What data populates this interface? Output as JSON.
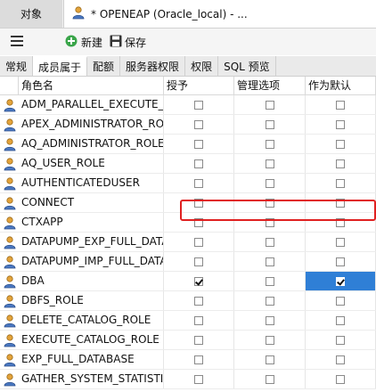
{
  "titlebar": {
    "objects_tab": "对象",
    "doc_tab": "* OPENEAP (Oracle_local) - ..."
  },
  "toolbar": {
    "new_label": "新建",
    "save_label": "保存"
  },
  "tabs": [
    {
      "label": "常规",
      "active": false
    },
    {
      "label": "成员属于",
      "active": true
    },
    {
      "label": "配额",
      "active": false
    },
    {
      "label": "服务器权限",
      "active": false
    },
    {
      "label": "权限",
      "active": false
    },
    {
      "label": "SQL 预览",
      "active": false
    }
  ],
  "grid": {
    "headers": [
      "角色名",
      "授予",
      "管理选项",
      "作为默认"
    ],
    "rows": [
      {
        "name": "ADM_PARALLEL_EXECUTE_TASK",
        "grant": false,
        "admin": false,
        "default": false
      },
      {
        "name": "APEX_ADMINISTRATOR_ROLE",
        "grant": false,
        "admin": false,
        "default": false
      },
      {
        "name": "AQ_ADMINISTRATOR_ROLE",
        "grant": false,
        "admin": false,
        "default": false
      },
      {
        "name": "AQ_USER_ROLE",
        "grant": false,
        "admin": false,
        "default": false
      },
      {
        "name": "AUTHENTICATEDUSER",
        "grant": false,
        "admin": false,
        "default": false
      },
      {
        "name": "CONNECT",
        "grant": false,
        "admin": false,
        "default": false
      },
      {
        "name": "CTXAPP",
        "grant": false,
        "admin": false,
        "default": false
      },
      {
        "name": "DATAPUMP_EXP_FULL_DATABASE",
        "grant": false,
        "admin": false,
        "default": false
      },
      {
        "name": "DATAPUMP_IMP_FULL_DATABASE",
        "grant": false,
        "admin": false,
        "default": false
      },
      {
        "name": "DBA",
        "grant": true,
        "admin": false,
        "default": true,
        "selected": true
      },
      {
        "name": "DBFS_ROLE",
        "grant": false,
        "admin": false,
        "default": false
      },
      {
        "name": "DELETE_CATALOG_ROLE",
        "grant": false,
        "admin": false,
        "default": false
      },
      {
        "name": "EXECUTE_CATALOG_ROLE",
        "grant": false,
        "admin": false,
        "default": false
      },
      {
        "name": "EXP_FULL_DATABASE",
        "grant": false,
        "admin": false,
        "default": false
      },
      {
        "name": "GATHER_SYSTEM_STATISTICS",
        "grant": false,
        "admin": false,
        "default": false
      }
    ]
  },
  "colors": {
    "selection": "#2f7fd6",
    "highlight_border": "#e02020"
  }
}
